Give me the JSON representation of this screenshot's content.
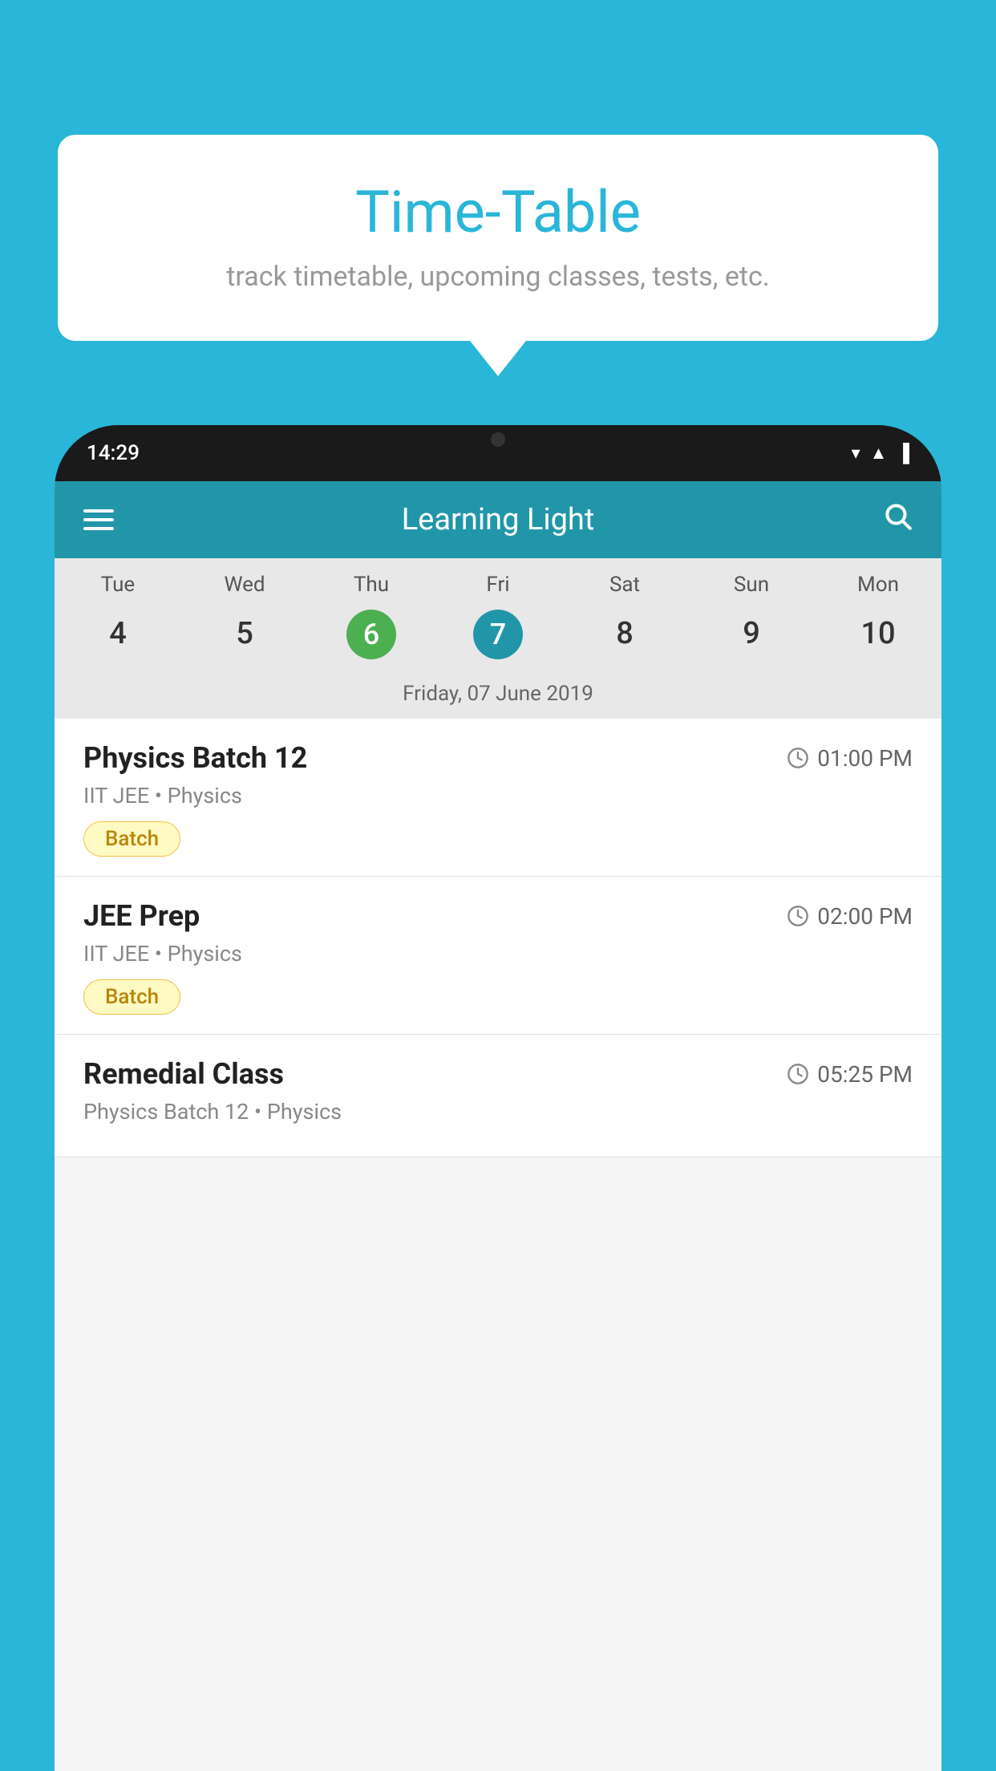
{
  "background_color": "#29B6D8",
  "speech_bubble": {
    "title": "Time-Table",
    "subtitle": "track timetable, upcoming classes, tests, etc."
  },
  "phone": {
    "status_bar": {
      "time": "14:29",
      "icons": [
        "wifi",
        "signal",
        "battery"
      ]
    },
    "app_header": {
      "title": "Learning Light",
      "search_label": "search"
    },
    "calendar": {
      "days": [
        "Tue",
        "Wed",
        "Thu",
        "Fri",
        "Sat",
        "Sun",
        "Mon"
      ],
      "dates": [
        "4",
        "5",
        "6",
        "7",
        "8",
        "9",
        "10"
      ],
      "today_index": 2,
      "selected_index": 3,
      "date_label": "Friday, 07 June 2019"
    },
    "schedule": [
      {
        "class_name": "Physics Batch 12",
        "time": "01:00 PM",
        "meta": "IIT JEE • Physics",
        "badge": "Batch"
      },
      {
        "class_name": "JEE Prep",
        "time": "02:00 PM",
        "meta": "IIT JEE • Physics",
        "badge": "Batch"
      },
      {
        "class_name": "Remedial Class",
        "time": "05:25 PM",
        "meta": "Physics Batch 12 • Physics",
        "badge": null
      }
    ]
  }
}
